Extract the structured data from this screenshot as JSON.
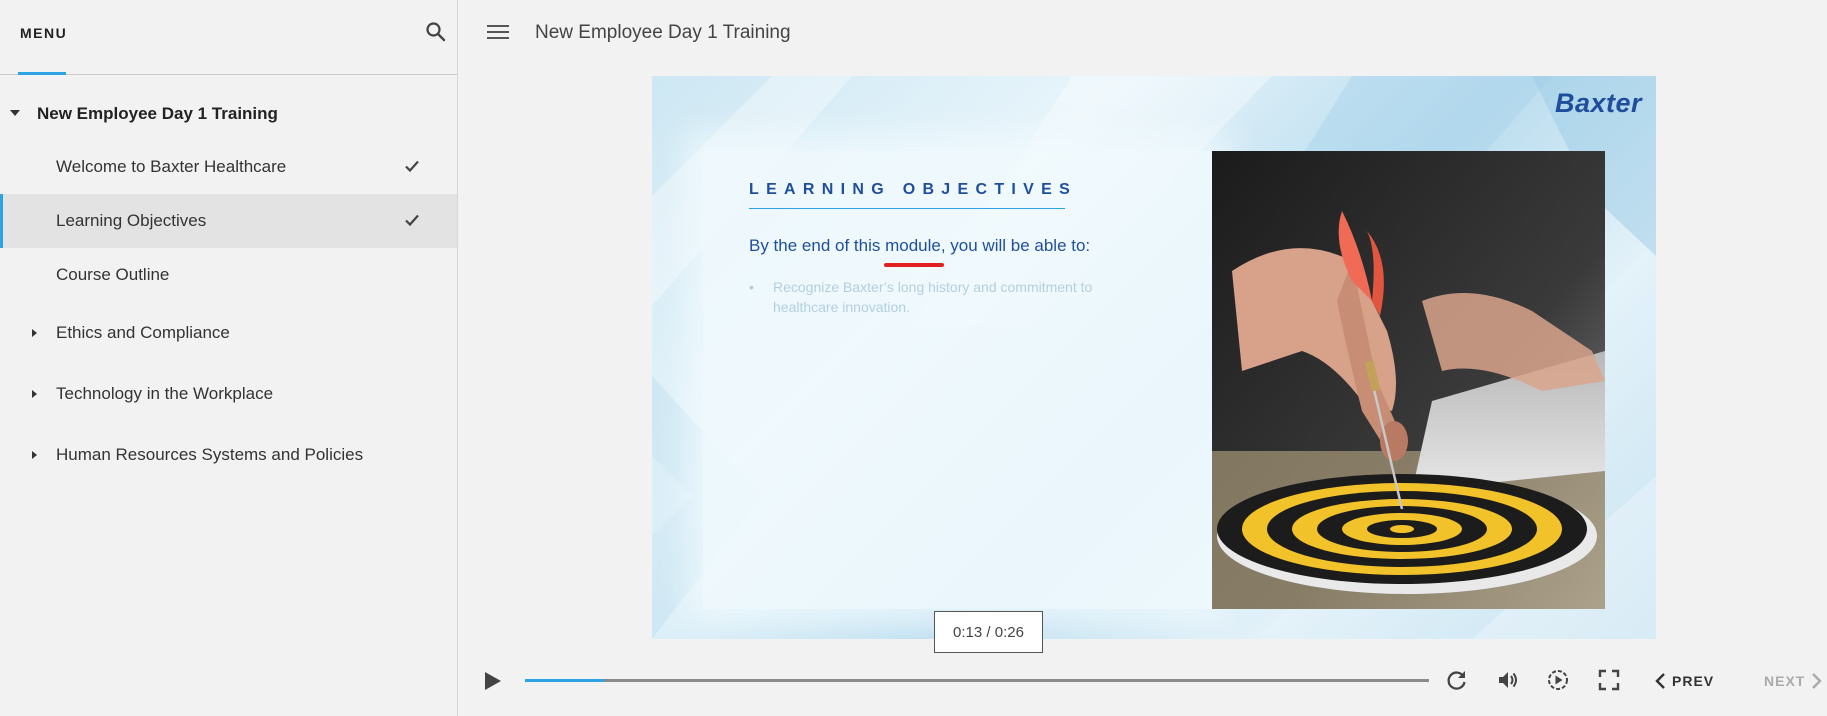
{
  "sidebar": {
    "menu_title": "MENU",
    "section_title": "New Employee Day 1 Training",
    "items": [
      {
        "label": "Welcome to Baxter Healthcare",
        "completed": true,
        "active": false
      },
      {
        "label": "Learning Objectives",
        "completed": true,
        "active": true
      },
      {
        "label": "Course Outline",
        "completed": false,
        "active": false
      }
    ],
    "groups": [
      {
        "label": "Ethics and Compliance"
      },
      {
        "label": "Technology in the Workplace"
      },
      {
        "label": "Human Resources Systems and Policies"
      }
    ]
  },
  "header": {
    "course_title": "New Employee Day 1 Training"
  },
  "slide": {
    "logo_text": "Baxter",
    "heading": "LEARNING OBJECTIVES",
    "intro": "By the end of this module, you will be able to:",
    "bullets": [
      "Recognize Baxter’s long history and commitment to healthcare innovation."
    ]
  },
  "player": {
    "time_tooltip": "0:13 / 0:26",
    "progress_fraction": 0.087,
    "prev_label": "PREV",
    "next_label": "NEXT",
    "accent_color": "#2ea3e3",
    "brand_color": "#1f4f9c"
  },
  "icons": {
    "search": "search-icon",
    "menu": "hamburger-icon",
    "check": "check-icon",
    "play": "play-icon",
    "replay": "replay-icon",
    "volume": "volume-icon",
    "playback_speed": "speed-icon",
    "fullscreen": "fullscreen-icon"
  }
}
